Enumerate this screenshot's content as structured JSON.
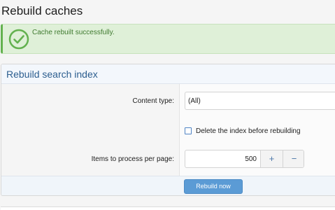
{
  "page": {
    "title": "Rebuild caches"
  },
  "alert": {
    "icon": "check-circle-icon",
    "message": "Cache rebuilt successfully."
  },
  "form": {
    "title": "Rebuild search index",
    "content_type_label": "Content type:",
    "content_type_value": "(All)",
    "delete_index_label": "Delete the index before rebuilding",
    "items_per_page_label": "Items to process per page:",
    "items_per_page_value": "500",
    "increment_symbol": "+",
    "decrement_symbol": "−",
    "submit_label": "Rebuild now"
  },
  "colors": {
    "success_background": "#dff0d8",
    "success_accent": "#63b14f",
    "heading_blue": "#2c5e8f",
    "button_blue": "#5b9bd5"
  }
}
